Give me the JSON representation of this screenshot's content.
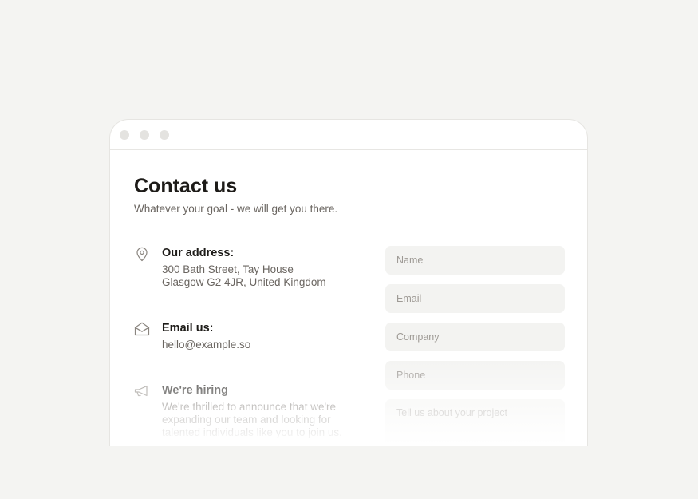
{
  "contact": {
    "title": "Contact us",
    "subtitle": "Whatever your goal - we will get you there.",
    "address": {
      "icon": "map-pin-icon",
      "heading": "Our address:",
      "line1": "300 Bath Street, Tay House",
      "line2": "Glasgow G2 4JR, United Kingdom"
    },
    "email": {
      "icon": "envelope-open-icon",
      "heading": "Email us:",
      "value": "hello@example.so"
    },
    "hiring": {
      "icon": "megaphone-icon",
      "heading": "We're hiring",
      "line1": "We're thrilled to announce that we're",
      "line2": "expanding our team and looking for",
      "line3": "talented individuals like you to join us."
    }
  },
  "form": {
    "name_placeholder": "Name",
    "email_placeholder": "Email",
    "company_placeholder": "Company",
    "phone_placeholder": "Phone",
    "project_placeholder": "Tell us about your project"
  },
  "colors": {
    "page_background": "#f4f4f2",
    "card_background": "#ffffff",
    "field_background": "#f3f3f1",
    "heading_text": "#1d1b18",
    "body_text": "#6a6560"
  }
}
